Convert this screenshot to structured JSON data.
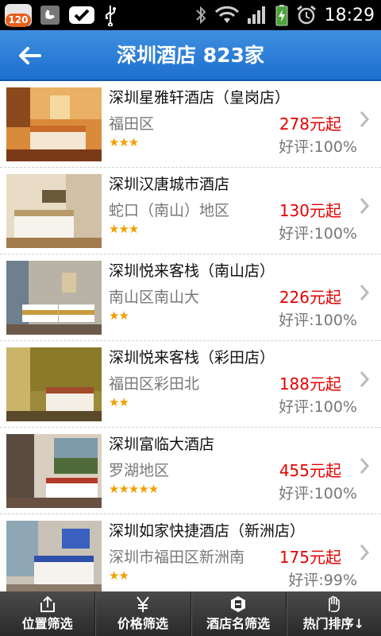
{
  "status_bar": {
    "notification_count": "120",
    "time": "18:29"
  },
  "header": {
    "title": "深圳酒店 823家"
  },
  "hotels": [
    {
      "name": "深圳星雅轩酒店（皇岗店）",
      "area": "福田区",
      "price": "278元起",
      "stars": "★★★",
      "rating": "好评:100%"
    },
    {
      "name": "深圳汉唐城市酒店",
      "area": "蛇口（南山）地区",
      "price": "130元起",
      "stars": "★★★",
      "rating": "好评:100%"
    },
    {
      "name": "深圳悦来客栈（南山店）",
      "area": "南山区南山大",
      "price": "226元起",
      "stars": "★★",
      "rating": "好评:100%"
    },
    {
      "name": "深圳悦来客栈（彩田店）",
      "area": "福田区彩田北",
      "price": "188元起",
      "stars": "★★",
      "rating": "好评:100%"
    },
    {
      "name": "深圳富临大酒店",
      "area": "罗湖地区",
      "price": "455元起",
      "stars": "★★★★★",
      "rating": "好评:100%"
    },
    {
      "name": "深圳如家快捷酒店（新洲店）",
      "area": "深圳市福田区新洲南",
      "price": "175元起",
      "stars": "★★",
      "rating": "好评:99%"
    }
  ],
  "bottom_tabs": [
    {
      "label": "位置筛选",
      "icon": "location-filter-icon"
    },
    {
      "label": "价格筛选",
      "icon": "yen-icon"
    },
    {
      "label": "酒店名筛选",
      "icon": "hotel-badge-icon"
    },
    {
      "label": "热门排序↓",
      "icon": "hand-icon"
    }
  ],
  "colors": {
    "title_bar": "#1d6fcf",
    "price": "#e60000",
    "stars": "#f0a000"
  }
}
